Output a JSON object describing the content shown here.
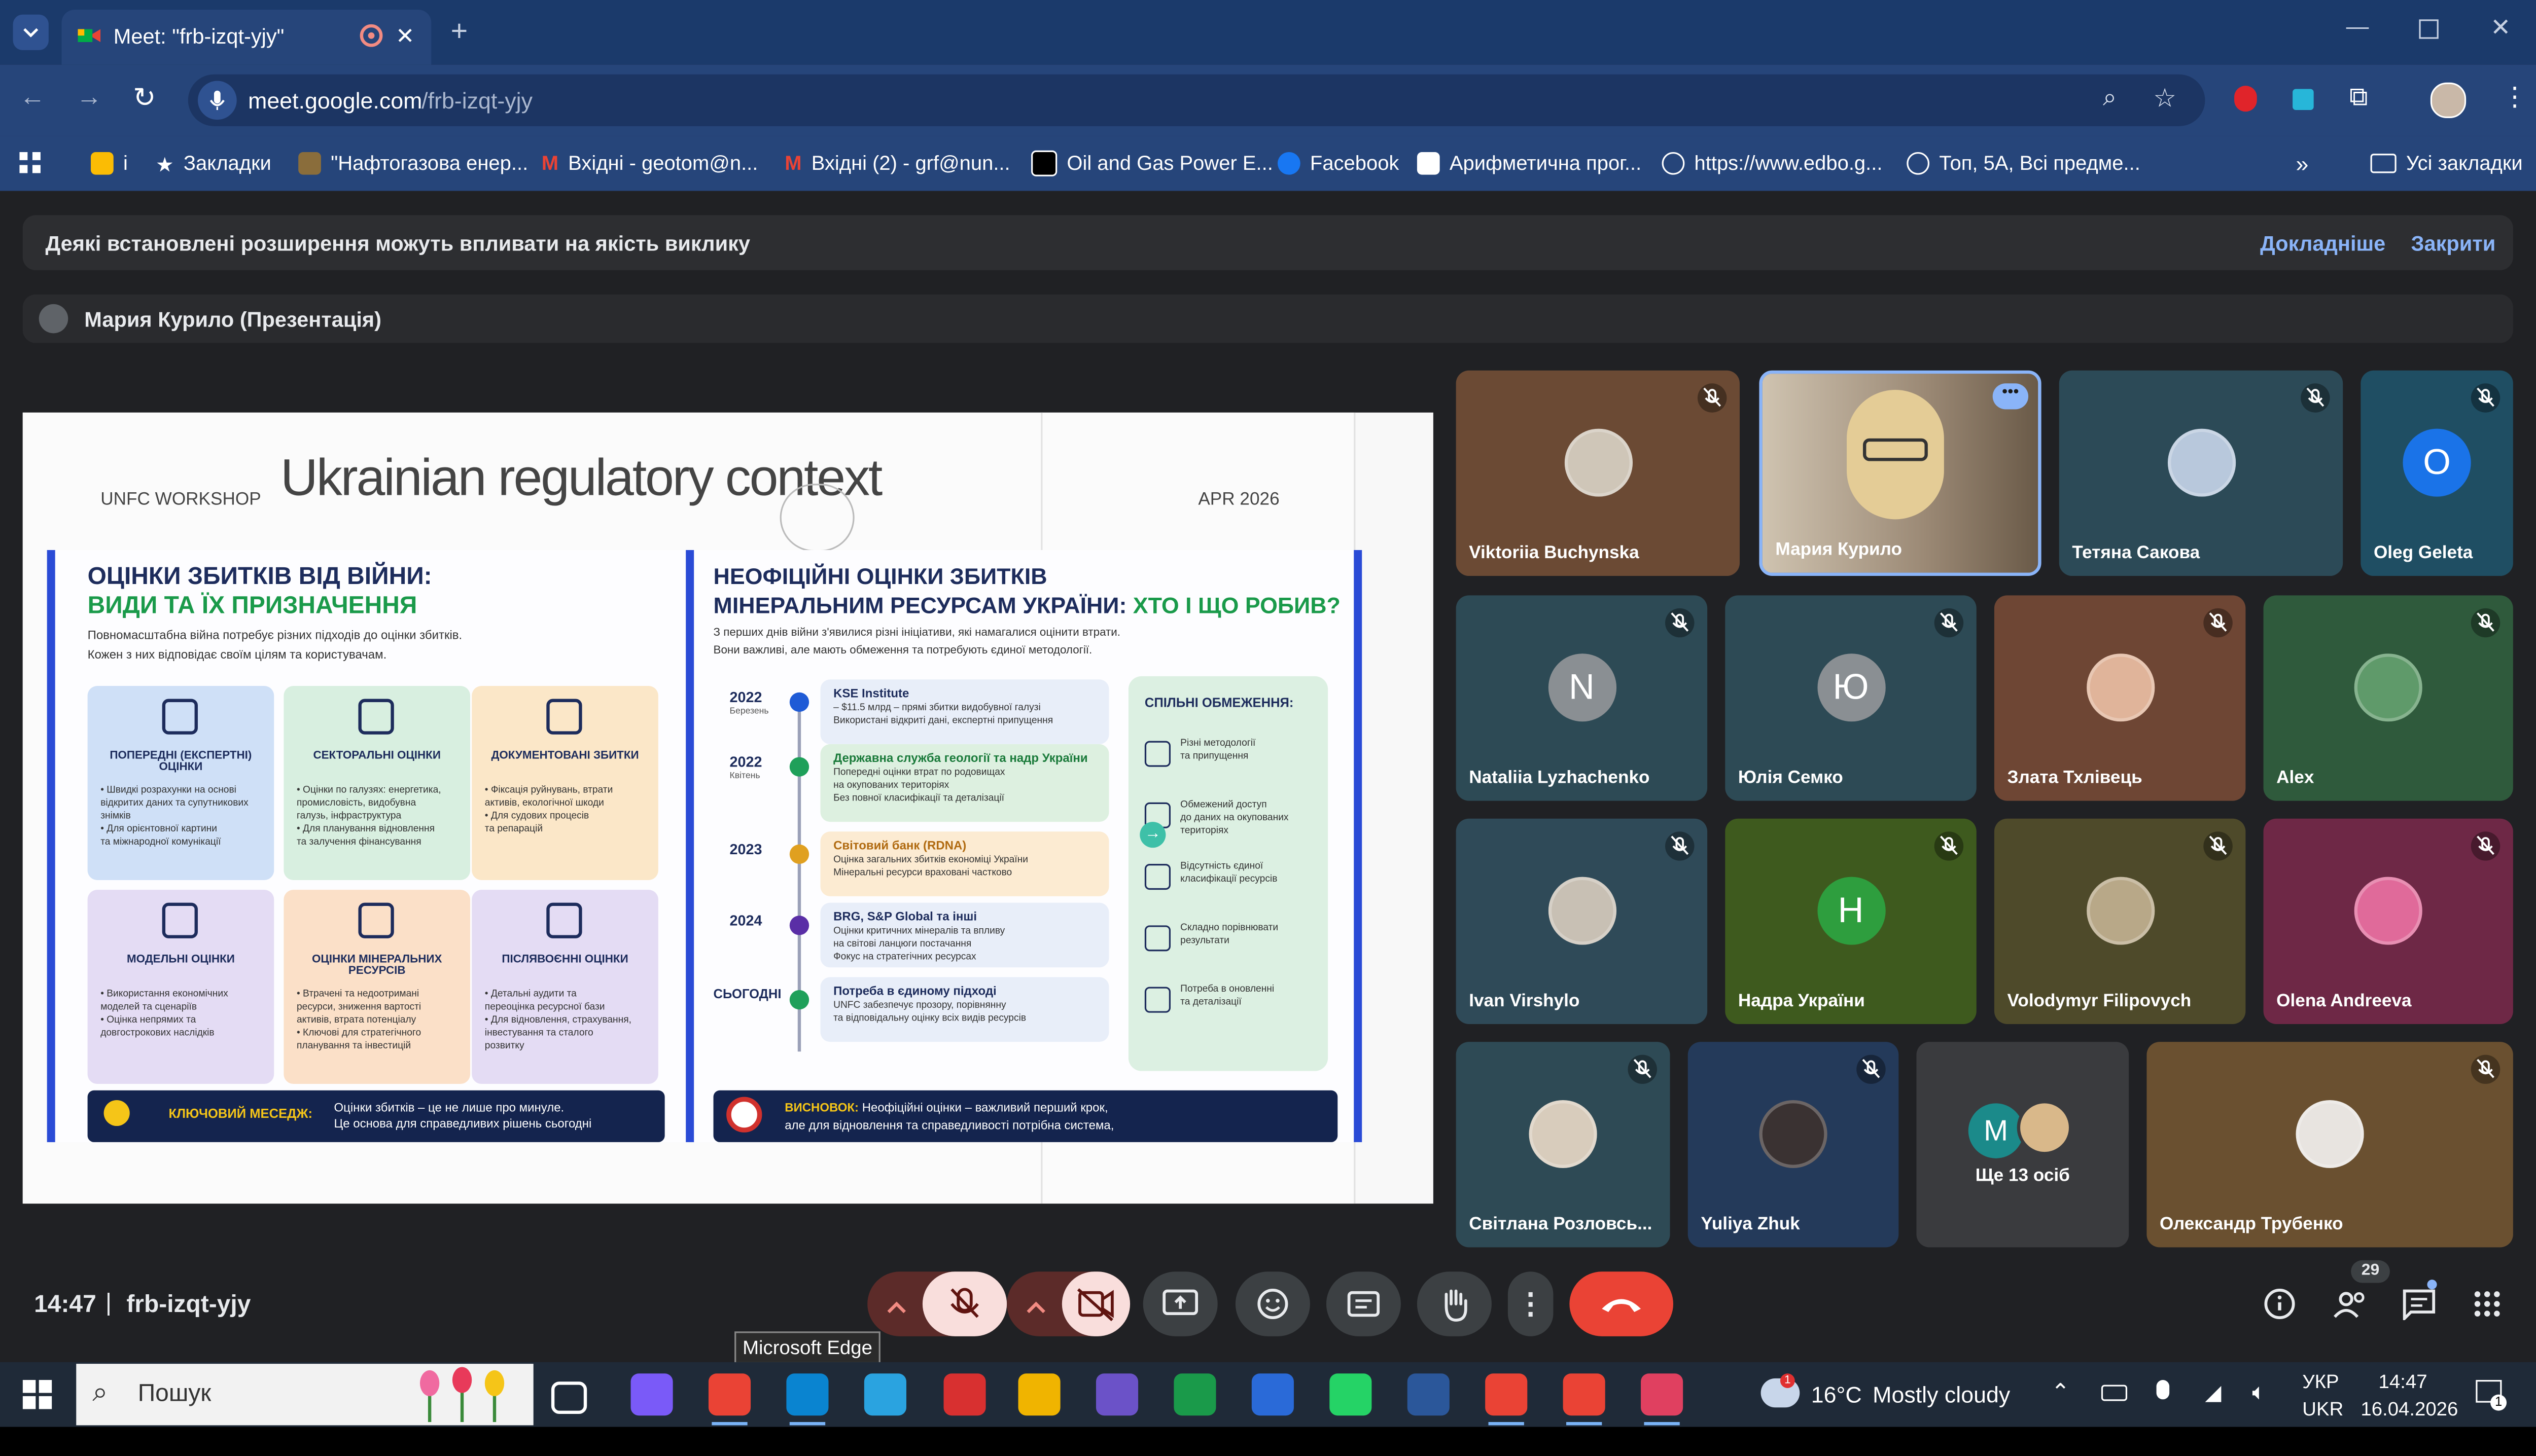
{
  "browser": {
    "tab_title": "Meet: \"frb-izqt-yjy\"",
    "url_domain": "meet.google.com",
    "url_path": "/frb-izqt-yjy",
    "bookmarks": [
      {
        "label": "і",
        "color": "#fbbc04"
      },
      {
        "label": "Закладки",
        "color": "#ffffff"
      },
      {
        "label": "\"Нафтогазова енер...",
        "color": "#8a6d3b"
      },
      {
        "label": "Вхідні - geotom@n...",
        "color": "#ea4335"
      },
      {
        "label": "Вхідні (2) - grf@nun...",
        "color": "#ea4335"
      },
      {
        "label": "Oil and Gas Power E...",
        "color": "#000000"
      },
      {
        "label": "Facebook",
        "color": "#1877f2"
      },
      {
        "label": "Арифметична прог...",
        "color": "#ffffff"
      },
      {
        "label": "https://www.edbo.g...",
        "color": "#ffffff"
      },
      {
        "label": "Топ, 5А, Всі предме...",
        "color": "#ffffff"
      }
    ],
    "all_bookmarks": "Усі закладки"
  },
  "meet": {
    "notice_text": "Деякі встановлені розширення можуть впливати на якість виклику",
    "notice_more": "Докладніше",
    "notice_close": "Закрити",
    "presenter_label": "Мария Курило (Презентація)",
    "time": "14:47",
    "separator": "|",
    "meeting_code": "frb-izqt-yjy",
    "participants_count": "29",
    "tooltip": "Microsoft Edge"
  },
  "slide": {
    "workshop": "UNFC WORKSHOP",
    "title": "Ukrainian regulatory context",
    "date": "APR 2026",
    "left": {
      "heading1": "ОЦІНКИ ЗБИТКІВ ВІД ВІЙНИ:",
      "heading2": "ВИДИ ТА ЇХ ПРИЗНАЧЕННЯ",
      "intro1": "Повномасштабна війна потребує різних підходів до оцінки збитків.",
      "intro2": "Кожен з них відповідає своїм цілям та користувачам.",
      "cards": [
        {
          "title": "ПОПЕРЕДНІ (ЕКСПЕРТНІ) ОЦІНКИ",
          "lines": [
            "• Швидкі розрахунки на основі",
            "відкритих даних та супутникових",
            "знімків",
            "• Для орієнтовної картини",
            "та міжнародної комунікації"
          ],
          "color": "#cfe0f7"
        },
        {
          "title": "СЕКТОРАЛЬНІ ОЦІНКИ",
          "lines": [
            "• Оцінки по галузях: енергетика,",
            "промисловість, видобувна",
            "галузь, інфраструктура",
            "• Для планування відновлення",
            "та залучення фінансування"
          ],
          "color": "#d8efe0"
        },
        {
          "title": "ДОКУМЕНТОВАНІ ЗБИТКИ",
          "lines": [
            "• Фіксація руйнувань, втрати",
            "активів, екологічної шкоди",
            "• Для судових процесів",
            "та репарацій"
          ],
          "color": "#fbe7c8"
        },
        {
          "title": "МОДЕЛЬНІ ОЦІНКИ",
          "lines": [
            "• Використання економічних",
            "моделей та сценаріїв",
            "• Оцінка непрямих та",
            "довгострокових наслідків"
          ],
          "color": "#e4dcf4"
        },
        {
          "title": "ОЦІНКИ МІНЕРАЛЬНИХ РЕСУРСІВ",
          "lines": [
            "• Втрачені та недоотримані",
            "ресурси, зниження вартості",
            "активів, втрата потенціалу",
            "• Ключові для стратегічного",
            "планування та інвестицій"
          ],
          "color": "#fbe0c8"
        },
        {
          "title": "ПІСЛЯВОЄННІ ОЦІНКИ",
          "lines": [
            "• Детальні аудити та",
            "переоцінка ресурсної бази",
            "• Для відновлення, страхування,",
            "інвестування та сталого",
            "розвитку"
          ],
          "color": "#e4dcf4"
        }
      ],
      "key_label": "КЛЮЧОВИЙ МЕСЕДЖ:",
      "key_text1": "Оцінки збитків – це не лише про минуле.",
      "key_text2": "Це основа для справедливих рішень сьогодні"
    },
    "right": {
      "heading1": "НЕОФІЦІЙНІ ОЦІНКИ ЗБИТКІВ",
      "heading2a": "МІНЕРАЛЬНИМ РЕСУРСАМ УКРАЇНИ: ",
      "heading2b": "ХТО І ЩО РОБИВ?",
      "intro1": "З перших днів війни з'явилися різні ініціативи, які намагалися оцінити втрати.",
      "intro2": "Вони важливі, але мають обмеження та потребують єдиної методології.",
      "timeline": [
        {
          "year": "2022",
          "sub": "Березень",
          "title": "KSE Institute",
          "lines": [
            "– $11.5 млрд – прямі збитки видобувної галузі",
            "Використані відкриті дані, експертні припущення"
          ],
          "color": "#1f5bd6"
        },
        {
          "year": "2022",
          "sub": "Квітень",
          "title": "Державна служба геології та надр України",
          "lines": [
            "Попередні оцінки втрат по родовищах",
            "на окупованих територіях",
            "Без повної класифікації та деталізації"
          ],
          "color": "#1fa05a"
        },
        {
          "year": "2023",
          "sub": "",
          "title": "Світовий банк (RDNA)",
          "lines": [
            "Оцінка загальних збитків економіці України",
            "Мінеральні ресурси враховані частково"
          ],
          "color": "#e0a020"
        },
        {
          "year": "2024",
          "sub": "",
          "title": "BRG, S&P Global та інші",
          "lines": [
            "Оцінки критичних мінералів та впливу",
            "на світові ланцюги постачання",
            "Фокус на стратегічних ресурсах"
          ],
          "color": "#5a2ea6"
        },
        {
          "year": "СЬОГОДНІ",
          "sub": "",
          "title": "Потреба в єдиному підході",
          "lines": [
            "UNFC забезпечує прозору, порівнянну",
            "та відповідальну оцінку всіх видів ресурсів"
          ],
          "color": "#1fa05a"
        }
      ],
      "limits_title": "СПІЛЬНІ ОБМЕЖЕННЯ:",
      "limits": [
        [
          "Різні методології",
          "та припущення"
        ],
        [
          "Обмежений доступ",
          "до даних на окупованих",
          "територіях"
        ],
        [
          "Відсутність єдиної",
          "класифікації ресурсів"
        ],
        [
          "Складно порівнювати",
          "результати"
        ],
        [
          "Потреба в оновленні",
          "та деталізації"
        ]
      ],
      "conclusion_label": "ВИСНОВОК:",
      "conclusion_text1": " Неофіційні оцінки – важливий перший крок,",
      "conclusion_text2": "але для відновлення та справедливості потрібна система,"
    }
  },
  "participants": [
    {
      "name": "Viktoriia Buchynska",
      "muted": true,
      "bg": "#6b4a34",
      "avatar": "photo",
      "avcolor": "#cfc6b8"
    },
    {
      "name": "Мария Курило",
      "muted": false,
      "bg": "#8a7a68",
      "avatar": "video",
      "avcolor": "#d9c7a8"
    },
    {
      "name": "Тетяна Сакова",
      "muted": true,
      "bg": "#2c4a57",
      "avatar": "photo",
      "avcolor": "#b8c8dc"
    },
    {
      "name": "Oleg Geleta",
      "muted": true,
      "bg": "#1f4e63",
      "avatar": "letter",
      "letter": "O",
      "avcolor": "#1a73e8"
    },
    {
      "name": "Nataliia Lyzhachenko",
      "muted": true,
      "bg": "#2d4a55",
      "avatar": "letter",
      "letter": "N",
      "avcolor": "#8a8f93"
    },
    {
      "name": "Юлія Семко",
      "muted": true,
      "bg": "#2d4a55",
      "avatar": "letter",
      "letter": "Ю",
      "avcolor": "#8a8f93"
    },
    {
      "name": "Злата Тхлівець",
      "muted": true,
      "bg": "#6e4634",
      "avatar": "photo",
      "avcolor": "#e0b49a"
    },
    {
      "name": "Alex",
      "muted": true,
      "bg": "#2f5a3c",
      "avatar": "photo",
      "avcolor": "#5f9a6a"
    },
    {
      "name": "Ivan Virshylo",
      "muted": true,
      "bg": "#2f4a58",
      "avatar": "photo",
      "avcolor": "#c8c0b4"
    },
    {
      "name": "Надра України",
      "muted": true,
      "bg": "#3e5a1e",
      "avatar": "letter",
      "letter": "Н",
      "avcolor": "#2e9e3e"
    },
    {
      "name": "Volodymyr Filipovych",
      "muted": true,
      "bg": "#4e4a2a",
      "avatar": "photo",
      "avcolor": "#b8a888"
    },
    {
      "name": "Olena Andreeva",
      "muted": true,
      "bg": "#6e2846",
      "avatar": "photo",
      "avcolor": "#e06a9a"
    },
    {
      "name": "Світлана Розловсь...",
      "muted": true,
      "bg": "#2e4a55",
      "avatar": "photo",
      "avcolor": "#d8ccbc"
    },
    {
      "name": "Yuliya Zhuk",
      "muted": true,
      "bg": "#243a5a",
      "avatar": "photo",
      "avcolor": "#3a3232"
    },
    {
      "name": "Ще 13 осіб",
      "muted": false,
      "bg": "#3a3b3e",
      "avatar": "more",
      "letter": "M",
      "avcolor": "#1b8a8a"
    },
    {
      "name": "Олександр Трубенко",
      "muted": true,
      "bg": "#6a5030",
      "avatar": "photo",
      "avcolor": "#e8e4e0"
    }
  ],
  "taskbar": {
    "search_label": "Пошук",
    "weather_temp": "16°C",
    "weather_text": "Mostly cloudy",
    "lang1": "УКР",
    "lang2": "UKR",
    "clock_time": "14:47",
    "clock_date": "16.04.2026",
    "notif_count": "1",
    "weather_badge": "1"
  }
}
